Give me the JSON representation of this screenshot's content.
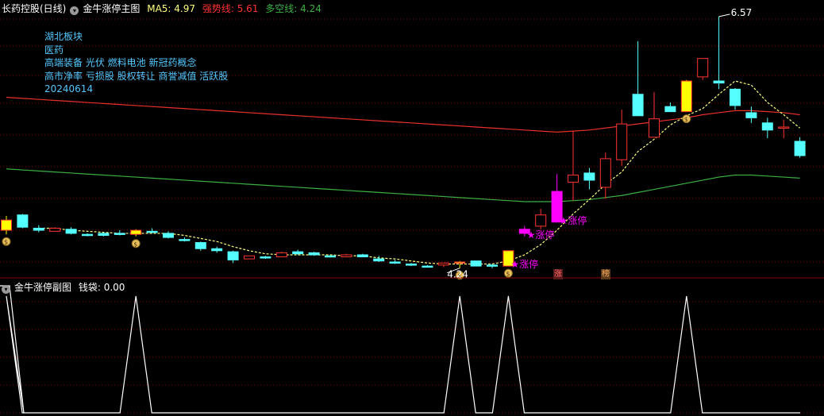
{
  "main_header": {
    "stock_title": "长药控股(日线)",
    "indicator_name": "金牛涨停主图",
    "ma5_label": "MA5:",
    "ma5_value": "4.97",
    "strong_label": "强势线:",
    "strong_value": "5.61",
    "longshort_label": "多空线:",
    "longshort_value": "4.24"
  },
  "sub_header": {
    "indicator_name": "金牛涨停副图",
    "money_label": "钱袋:",
    "money_value": "0.00"
  },
  "info_lines": [
    "湖北板块",
    "医药",
    "高端装备 光伏 燃料电池 新冠药概念",
    "高市净率 亏损股 股权转让 商誉减值 活跃股",
    "20240614"
  ],
  "annotations": {
    "limit_up": "★涨停",
    "high_price": "6.57",
    "low_price": "4.24",
    "badge_zhang": "涨",
    "badge_bang": "榜"
  },
  "colors": {
    "up": "#ff3232",
    "down": "#54ffff",
    "limit_up_yellow": "#ffff00",
    "limit_up_magenta": "#ff00ff",
    "ma5": "#ffff80",
    "strong_line": "#e8302a",
    "longshort_line": "#3cb043",
    "grid": "#8b0000",
    "sub_line": "#ffffff"
  },
  "chart_data": {
    "type": "candlestick",
    "ohlc_note": "daily K-line; values estimated from the price axis (high 6.57, low 4.24)",
    "candles": [
      {
        "o": 4.58,
        "h": 4.62,
        "l": 4.44,
        "c": 4.48,
        "k": "Y"
      },
      {
        "o": 4.63,
        "h": 4.64,
        "l": 4.5,
        "c": 4.51,
        "k": "D"
      },
      {
        "o": 4.5,
        "h": 4.53,
        "l": 4.46,
        "c": 4.48,
        "k": "D"
      },
      {
        "o": 4.47,
        "h": 4.51,
        "l": 4.47,
        "c": 4.5,
        "k": "U"
      },
      {
        "o": 4.49,
        "h": 4.51,
        "l": 4.44,
        "c": 4.45,
        "k": "D"
      },
      {
        "o": 4.44,
        "h": 4.45,
        "l": 4.42,
        "c": 4.44,
        "k": "D"
      },
      {
        "o": 4.45,
        "h": 4.46,
        "l": 4.42,
        "c": 4.43,
        "k": "D"
      },
      {
        "o": 4.45,
        "h": 4.48,
        "l": 4.43,
        "c": 4.45,
        "k": "D"
      },
      {
        "o": 4.44,
        "h": 4.49,
        "l": 4.42,
        "c": 4.48,
        "k": "Y"
      },
      {
        "o": 4.46,
        "h": 4.5,
        "l": 4.45,
        "c": 4.47,
        "k": "D"
      },
      {
        "o": 4.45,
        "h": 4.47,
        "l": 4.4,
        "c": 4.41,
        "k": "D"
      },
      {
        "o": 4.39,
        "h": 4.41,
        "l": 4.37,
        "c": 4.38,
        "k": "D"
      },
      {
        "o": 4.36,
        "h": 4.37,
        "l": 4.28,
        "c": 4.3,
        "k": "D"
      },
      {
        "o": 4.3,
        "h": 4.32,
        "l": 4.26,
        "c": 4.28,
        "k": "D"
      },
      {
        "o": 4.27,
        "h": 4.28,
        "l": 4.16,
        "c": 4.19,
        "k": "D"
      },
      {
        "o": 4.2,
        "h": 4.23,
        "l": 4.2,
        "c": 4.23,
        "k": "U"
      },
      {
        "o": 4.22,
        "h": 4.23,
        "l": 4.2,
        "c": 4.22,
        "k": "D"
      },
      {
        "o": 4.22,
        "h": 4.27,
        "l": 4.22,
        "c": 4.26,
        "k": "U"
      },
      {
        "o": 4.27,
        "h": 4.29,
        "l": 4.24,
        "c": 4.25,
        "k": "D"
      },
      {
        "o": 4.26,
        "h": 4.27,
        "l": 4.23,
        "c": 4.24,
        "k": "D"
      },
      {
        "o": 4.23,
        "h": 4.24,
        "l": 4.22,
        "c": 4.23,
        "k": "D"
      },
      {
        "o": 4.22,
        "h": 4.25,
        "l": 4.22,
        "c": 4.24,
        "k": "U"
      },
      {
        "o": 4.24,
        "h": 4.25,
        "l": 4.22,
        "c": 4.22,
        "k": "D"
      },
      {
        "o": 4.2,
        "h": 4.23,
        "l": 4.17,
        "c": 4.18,
        "k": "D"
      },
      {
        "o": 4.17,
        "h": 4.19,
        "l": 4.15,
        "c": 4.16,
        "k": "D"
      },
      {
        "o": 4.15,
        "h": 4.16,
        "l": 4.13,
        "c": 4.14,
        "k": "D"
      },
      {
        "o": 4.13,
        "h": 4.14,
        "l": 4.12,
        "c": 4.13,
        "k": "D"
      },
      {
        "o": 4.14,
        "h": 4.16,
        "l": 4.12,
        "c": 4.16,
        "k": "U"
      },
      {
        "o": 4.16,
        "h": 4.18,
        "l": 4.11,
        "c": 4.17,
        "k": "Y"
      },
      {
        "o": 4.18,
        "h": 4.18,
        "l": 4.13,
        "c": 4.13,
        "k": "D"
      },
      {
        "o": 4.13,
        "h": 4.15,
        "l": 4.11,
        "c": 4.14,
        "k": "D"
      },
      {
        "o": 4.13,
        "h": 4.28,
        "l": 4.13,
        "c": 4.28,
        "k": "Y"
      },
      {
        "o": 4.49,
        "h": 4.52,
        "l": 4.42,
        "c": 4.45,
        "k": "M"
      },
      {
        "o": 4.52,
        "h": 4.69,
        "l": 4.49,
        "c": 4.63,
        "k": "U"
      },
      {
        "o": 4.56,
        "h": 5.03,
        "l": 4.56,
        "c": 4.86,
        "k": "M"
      },
      {
        "o": 4.95,
        "h": 5.45,
        "l": 4.77,
        "c": 5.02,
        "k": "U"
      },
      {
        "o": 5.04,
        "h": 5.09,
        "l": 4.88,
        "c": 4.97,
        "k": "D"
      },
      {
        "o": 4.9,
        "h": 5.24,
        "l": 4.79,
        "c": 5.18,
        "k": "U"
      },
      {
        "o": 5.52,
        "h": 5.66,
        "l": 5.11,
        "c": 5.17,
        "k": "U"
      },
      {
        "o": 5.6,
        "h": 6.33,
        "l": 5.6,
        "c": 5.81,
        "k": "D"
      },
      {
        "o": 5.39,
        "h": 5.83,
        "l": 5.39,
        "c": 5.57,
        "k": "U"
      },
      {
        "o": 5.69,
        "h": 5.73,
        "l": 5.64,
        "c": 5.64,
        "k": "D"
      },
      {
        "o": 5.94,
        "h": 5.95,
        "l": 5.64,
        "c": 5.64,
        "k": "Y"
      },
      {
        "o": 5.98,
        "h": 6.16,
        "l": 5.95,
        "c": 6.16,
        "k": "U"
      },
      {
        "o": 5.94,
        "h": 6.57,
        "l": 5.86,
        "c": 5.92,
        "k": "D"
      },
      {
        "o": 5.86,
        "h": 5.87,
        "l": 5.66,
        "c": 5.7,
        "k": "D"
      },
      {
        "o": 5.63,
        "h": 5.69,
        "l": 5.53,
        "c": 5.58,
        "k": "D"
      },
      {
        "o": 5.53,
        "h": 5.58,
        "l": 5.38,
        "c": 5.46,
        "k": "D"
      },
      {
        "o": 5.49,
        "h": 5.56,
        "l": 5.38,
        "c": 5.48,
        "k": "U"
      },
      {
        "o": 5.35,
        "h": 5.39,
        "l": 5.19,
        "c": 5.21,
        "k": "D"
      }
    ],
    "ma5": [
      null,
      null,
      4.5,
      4.5,
      4.48,
      4.47,
      4.46,
      4.45,
      4.45,
      4.45,
      4.45,
      4.43,
      4.4,
      4.37,
      4.32,
      4.28,
      4.25,
      4.24,
      4.24,
      4.24,
      4.24,
      4.23,
      4.23,
      4.21,
      4.2,
      4.18,
      4.16,
      4.15,
      4.15,
      4.15,
      4.15,
      4.18,
      4.24,
      4.34,
      4.48,
      4.64,
      4.78,
      4.93,
      5.05,
      5.25,
      5.37,
      5.51,
      5.6,
      5.67,
      5.81,
      5.94,
      5.9,
      5.73,
      5.61,
      5.48
    ],
    "strong_line": [
      5.78,
      5.77,
      5.76,
      5.75,
      5.74,
      5.73,
      5.72,
      5.71,
      5.7,
      5.69,
      5.68,
      5.67,
      5.66,
      5.65,
      5.64,
      5.63,
      5.62,
      5.61,
      5.6,
      5.59,
      5.58,
      5.57,
      5.56,
      5.55,
      5.54,
      5.53,
      5.52,
      5.51,
      5.5,
      5.49,
      5.48,
      5.47,
      5.46,
      5.45,
      5.44,
      5.45,
      5.46,
      5.48,
      5.5,
      5.52,
      5.54,
      5.56,
      5.58,
      5.61,
      5.63,
      5.65,
      5.65,
      5.64,
      5.63,
      5.61
    ],
    "longshort_line": [
      5.08,
      5.07,
      5.06,
      5.05,
      5.04,
      5.03,
      5.02,
      5.01,
      5.0,
      4.99,
      4.98,
      4.97,
      4.96,
      4.95,
      4.94,
      4.93,
      4.92,
      4.91,
      4.9,
      4.89,
      4.88,
      4.87,
      4.86,
      4.85,
      4.84,
      4.83,
      4.82,
      4.81,
      4.8,
      4.79,
      4.78,
      4.77,
      4.76,
      4.76,
      4.76,
      4.77,
      4.78,
      4.8,
      4.82,
      4.85,
      4.88,
      4.91,
      4.94,
      4.97,
      5.0,
      5.02,
      5.02,
      5.01,
      5.0,
      4.99
    ],
    "money_bag": [
      1,
      0,
      0,
      0,
      0,
      0,
      0,
      0,
      1,
      0,
      0,
      0,
      0,
      0,
      0,
      0,
      0,
      0,
      0,
      0,
      0,
      0,
      0,
      0,
      0,
      0,
      0,
      0,
      1,
      0,
      0,
      1,
      0,
      0,
      0,
      0,
      0,
      0,
      0,
      0,
      0,
      0,
      1,
      0,
      0,
      0,
      0,
      0,
      0,
      0
    ],
    "limit_up_days": [
      31,
      32,
      34
    ],
    "high_label_index": 44,
    "low_label_index": 28,
    "ylim": [
      4.1,
      6.6
    ]
  }
}
